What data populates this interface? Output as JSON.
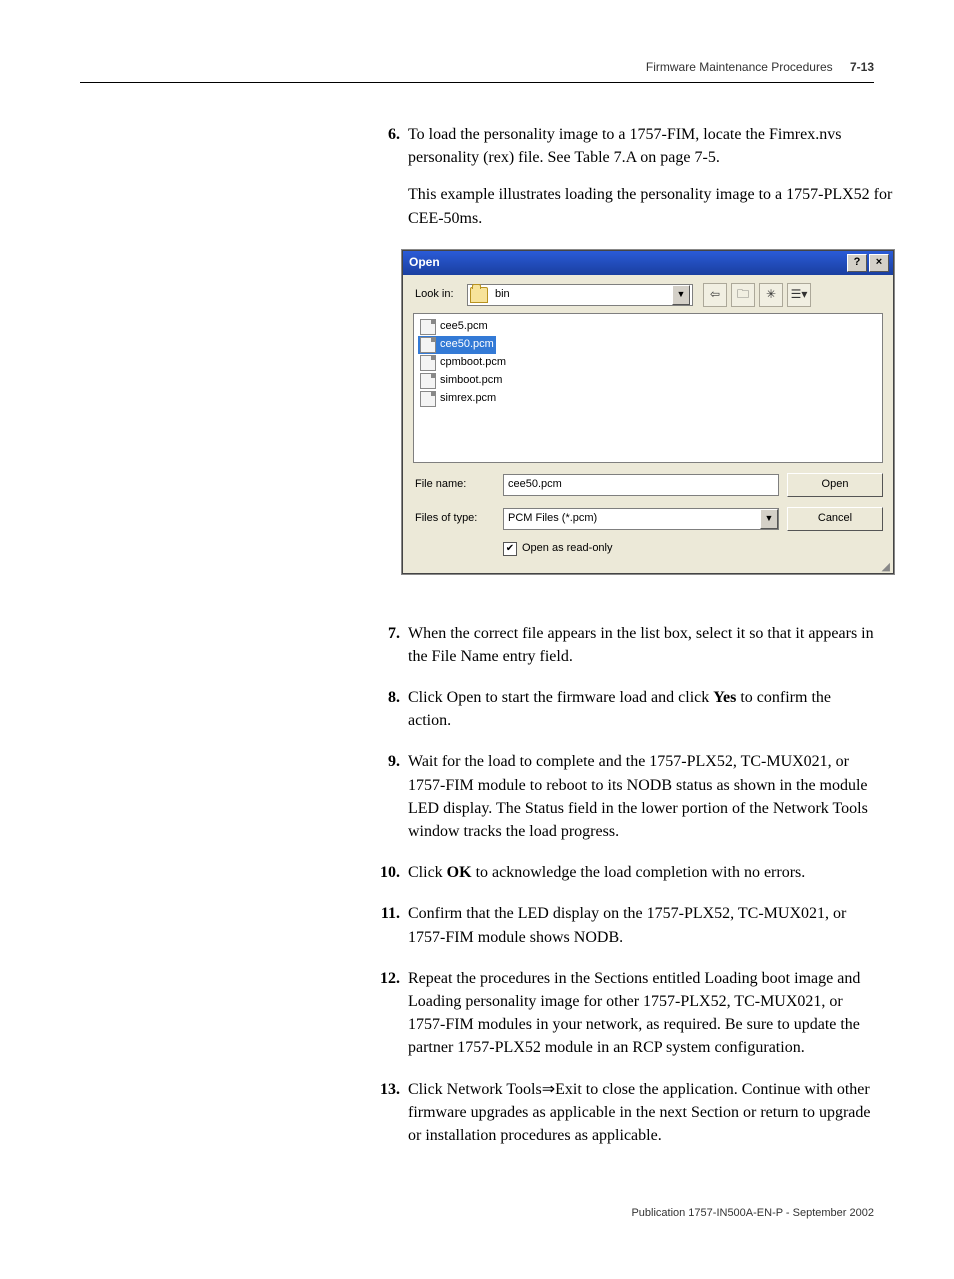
{
  "header": {
    "section": "Firmware Maintenance Procedures",
    "pagenum": "7-13"
  },
  "steps": {
    "s6": {
      "num": "6.",
      "text": "To load the personality image to a 1757-FIM, locate the Fimrex.nvs personality (rex) file. See Table 7.A on page 7-5.",
      "sub": "This example illustrates loading the personality image to a 1757-PLX52 for CEE-50ms."
    },
    "s7": {
      "num": "7.",
      "text": "When the correct file appears in the list box, select it so that it appears in the File Name entry field."
    },
    "s8": {
      "num": "8.",
      "text_before": "Click Open to start the firmware load and click ",
      "bold": "Yes",
      "text_after": " to confirm the action."
    },
    "s9": {
      "num": "9.",
      "text": "Wait for the load to complete and the 1757-PLX52, TC-MUX021, or 1757-FIM module to reboot to its NODB status as shown in the module LED display. The Status field in the lower portion of the Network Tools window tracks the load progress."
    },
    "s10": {
      "num": "10.",
      "text_before": "Click ",
      "bold": "OK",
      "text_after": " to acknowledge the load completion with no errors."
    },
    "s11": {
      "num": "11.",
      "text": "Confirm that the LED display on the 1757-PLX52, TC-MUX021, or 1757-FIM module shows NODB."
    },
    "s12": {
      "num": "12.",
      "text": "Repeat the procedures in the Sections entitled Loading boot image and Loading personality image for other 1757-PLX52, TC-MUX021, or 1757-FIM modules in your network, as required. Be sure to update the partner 1757-PLX52 module in an RCP system configuration."
    },
    "s13": {
      "num": "13.",
      "text": "Click Network Tools⇒Exit to close the application. Continue with other firmware upgrades as applicable in the next Section or return to upgrade or installation procedures as applicable."
    }
  },
  "dialog": {
    "title": "Open",
    "help_btn": "?",
    "close_btn": "×",
    "lookin_label": "Look in:",
    "lookin_value": "bin",
    "tool_icons": {
      "back": "⇦",
      "up": "🗀",
      "new": "✳",
      "views": "☰▾"
    },
    "files": [
      "cee5.pcm",
      "cee50.pcm",
      "cpmboot.pcm",
      "simboot.pcm",
      "simrex.pcm"
    ],
    "selected_file": "cee50.pcm",
    "filename_label": "File name:",
    "filename_value": "cee50.pcm",
    "filetype_label": "Files of type:",
    "filetype_value": "PCM Files (*.pcm)",
    "open_btn": "Open",
    "cancel_btn": "Cancel",
    "readonly_label": "Open as read-only",
    "readonly_checked": "✔"
  },
  "footer": "Publication 1757-IN500A-EN-P - September 2002"
}
